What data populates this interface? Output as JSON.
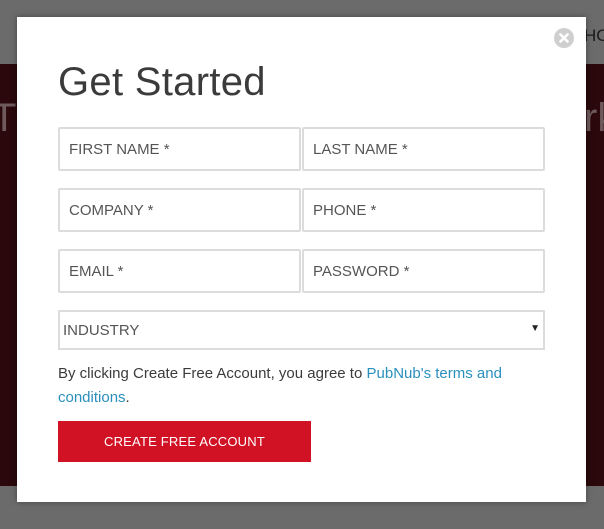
{
  "background": {
    "nav_fragment": "HO",
    "hero_left_fragment": "T",
    "hero_right_fragment": "rk",
    "band_color": "#2a080b"
  },
  "modal": {
    "title": "Get Started",
    "close_icon": "close-circle-icon",
    "fields": {
      "first_name": {
        "placeholder": "FIRST NAME *",
        "value": ""
      },
      "last_name": {
        "placeholder": "LAST NAME *",
        "value": ""
      },
      "company": {
        "placeholder": "COMPANY *",
        "value": ""
      },
      "phone": {
        "placeholder": "PHONE *",
        "value": ""
      },
      "email": {
        "placeholder": "EMAIL *",
        "value": ""
      },
      "password": {
        "placeholder": "PASSWORD *",
        "value": ""
      }
    },
    "industry_select": {
      "selected": "INDUSTRY",
      "arrow": "▼"
    },
    "terms": {
      "prefix": "By clicking Create Free Account, you agree to ",
      "link_text": "PubNub's terms and conditions",
      "suffix": "."
    },
    "submit_label": "CREATE FREE ACCOUNT",
    "colors": {
      "accent": "#d11124",
      "link": "#2a8fbd"
    }
  }
}
